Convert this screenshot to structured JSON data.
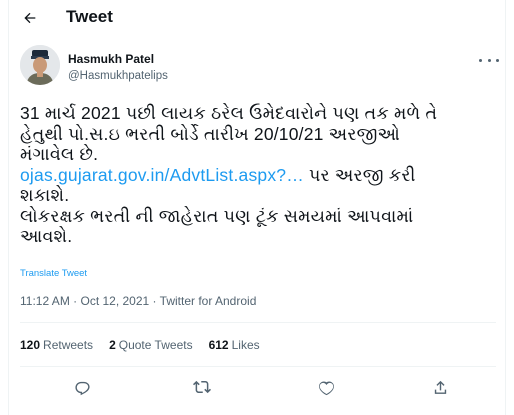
{
  "header": {
    "title": "Tweet"
  },
  "icons": {
    "back": "arrow-left-icon",
    "more": "more-horizontal-icon",
    "reply": "reply-icon",
    "retweet": "retweet-icon",
    "like": "heart-icon",
    "share": "share-icon"
  },
  "colors": {
    "accent": "#1d9bf0",
    "text": "#0f1419",
    "muted": "#536471",
    "border": "#eff3f4"
  },
  "author": {
    "name": "Hasmukh Patel",
    "handle": "@Hasmukhpatelips"
  },
  "tweet": {
    "line1": "31 માર્ચ 2021 પછી લાયક ઠરેલ ઉમેદવારોને પણ તક મળે તે",
    "line2": "હેતુથી પો.સ.ઇ ભરતી બોર્ડે તારીખ 20/10/21 અરજીઓ",
    "line3": "મંગાવેલ છે.",
    "link": "ojas.gujarat.gov.in/AdvtList.aspx?…",
    "line4_rest": " પર અરજી કરી",
    "line5": "શકાશે.",
    "line6": "લોકરક્ષક ભરતી ની જાહેરાત પણ ટૂંક સમયમાં આપવામાં",
    "line7": "આવશે."
  },
  "translate_label": "Translate Tweet",
  "meta": {
    "time": "11:12 AM",
    "date": "Oct 12, 2021",
    "source": "Twitter for Android",
    "sep": " · "
  },
  "stats": {
    "retweets_count": "120",
    "retweets_label": "Retweets",
    "quotes_count": "2",
    "quotes_label": "Quote Tweets",
    "likes_count": "612",
    "likes_label": "Likes"
  }
}
